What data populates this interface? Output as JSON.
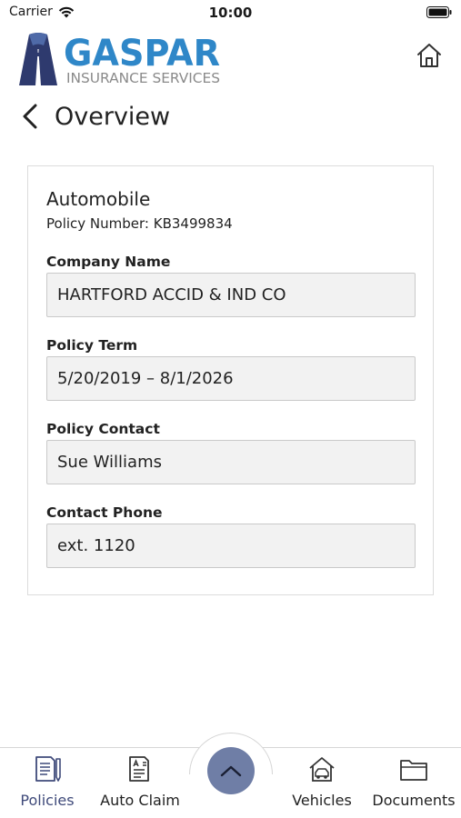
{
  "status_bar": {
    "carrier": "Carrier",
    "time": "10:00"
  },
  "header": {
    "logo_name": "GASPAR",
    "logo_tagline": "INSURANCE SERVICES",
    "home_icon": "home-icon"
  },
  "page": {
    "title": "Overview",
    "back_icon": "chevron-left-icon"
  },
  "policy": {
    "type": "Automobile",
    "number_text": "Policy Number: KB3499834",
    "fields": [
      {
        "label": "Company Name",
        "value": "HARTFORD ACCID & IND CO"
      },
      {
        "label": "Policy Term",
        "value": "5/20/2019 – 8/1/2026"
      },
      {
        "label": "Policy Contact",
        "value": "Sue Williams"
      },
      {
        "label": "Contact Phone",
        "value": "ext. 1120"
      }
    ]
  },
  "bottom_nav": {
    "items": [
      {
        "label": "Policies",
        "icon": "policies-icon",
        "active": true
      },
      {
        "label": "Auto Claim",
        "icon": "auto-claim-icon",
        "active": false
      },
      {
        "label": "Vehicles",
        "icon": "vehicles-icon",
        "active": false
      },
      {
        "label": "Documents",
        "icon": "documents-icon",
        "active": false
      }
    ],
    "center_button_icon": "chevron-up-icon"
  },
  "colors": {
    "brand_blue": "#2f87c8",
    "brand_navy": "#2e3a6e",
    "active_nav": "#3f4a7a",
    "fab": "#6f7ea6",
    "field_bg": "#f2f2f2"
  }
}
